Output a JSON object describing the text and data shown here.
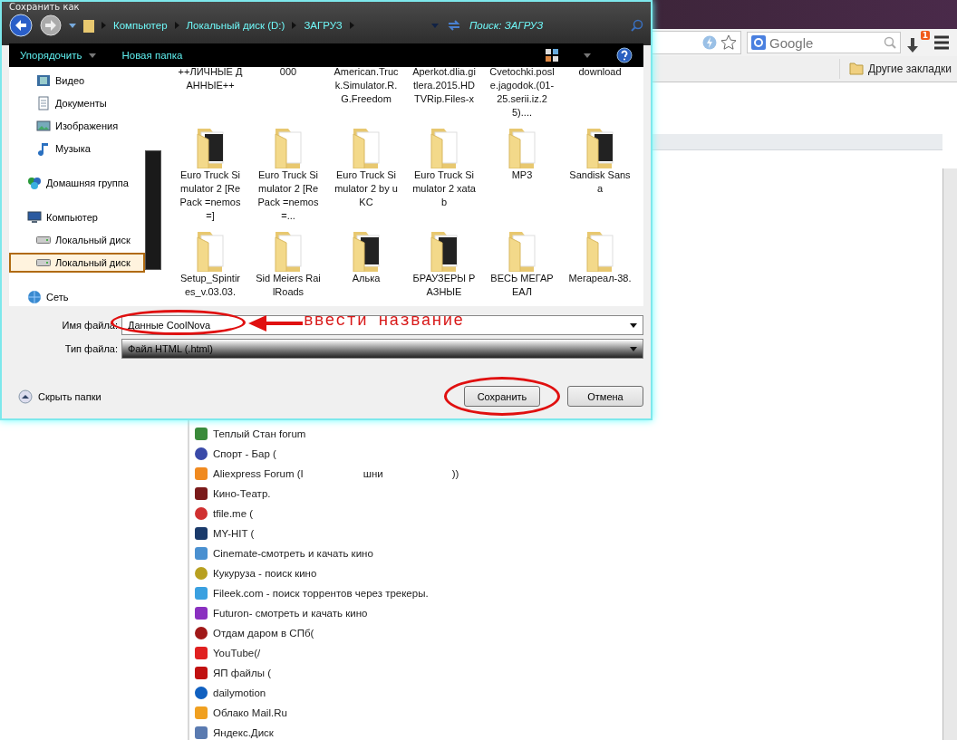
{
  "browser": {
    "search": {
      "placeholder": "Google"
    },
    "download_badge": "1",
    "bookmarks_bar": {
      "other": "Другие закладки"
    },
    "bookmarks": [
      {
        "text": "Теплый Стан forum",
        "color": "#3a8a3a"
      },
      {
        "text": "Спорт - Бар (",
        "color": "#3a4aa8"
      },
      {
        "text": "Aliexpress Forum (I",
        "color": "#f08a20",
        "fragments": [
          "шни",
          "))"
        ]
      },
      {
        "text": "Кино-Театр.",
        "color": "#7a1a1a"
      },
      {
        "text": "tfile.me (",
        "color": "#d03030"
      },
      {
        "text": "MY-HIT (",
        "color": "#1a3a6a"
      },
      {
        "text": "Cinemate-смотреть и качать кино",
        "color": "#4a90d0"
      },
      {
        "text": "Кукуруза - поиск кино",
        "color": "#b8a020"
      },
      {
        "text": "Fileek.com - поиск торрентов через трекеры.",
        "color": "#3aa0e0"
      },
      {
        "text": "Futuron- смотреть и качать кино",
        "color": "#8a30c0"
      },
      {
        "text": "Отдам даром в СПб(",
        "color": "#a01818"
      },
      {
        "text": "YouTube(/",
        "color": "#e02020"
      },
      {
        "text": "ЯП файлы (",
        "color": "#c01010"
      },
      {
        "text": "dailymotion",
        "color": "#1060c0"
      },
      {
        "text": "Облако Mail.Ru",
        "color": "#f0a020"
      },
      {
        "text": "Яндекс.Диск",
        "color": "#5a7ab0"
      }
    ]
  },
  "dialog": {
    "title": "Сохранить как",
    "breadcrumbs": [
      "Компьютер",
      "Локальный диск (D:)",
      "ЗАГРУЗ"
    ],
    "search": {
      "placeholder": "Поиск: ЗАГРУЗ"
    },
    "toolbar": {
      "organize": "Упорядочить",
      "new_folder": "Новая папка"
    },
    "nav": [
      {
        "children": [
          {
            "label": "Видео",
            "kind": "video",
            "selected": false
          },
          {
            "label": "Документы",
            "kind": "docs",
            "selected": false
          },
          {
            "label": "Изображения",
            "kind": "images",
            "selected": false
          },
          {
            "label": "Музыка",
            "kind": "music",
            "selected": false
          }
        ]
      },
      {
        "label": "Домашняя группа",
        "kind": "homegroup",
        "selected": false
      },
      {
        "label": "Компьютер",
        "kind": "computer",
        "selected": false,
        "children": [
          {
            "label": "Локальный диск",
            "kind": "drive",
            "selected": false
          },
          {
            "label": "Локальный диск",
            "kind": "drive",
            "selected": true
          }
        ]
      },
      {
        "label": "Сеть",
        "kind": "network",
        "selected": false
      }
    ],
    "files": [
      {
        "name": "++ЛИЧНЫЕ ДАННЫЕ++",
        "kind": "name_only"
      },
      {
        "name": "000",
        "kind": "name_only"
      },
      {
        "name": "American.Truck.Simulator.R.G.Freedom",
        "kind": "name_only"
      },
      {
        "name": "Aperkot.dlia.gitlera.2015.HDTVRip.Files-x",
        "kind": "name_only"
      },
      {
        "name": "Cvetochki.posle.jagodok.(01-25.serii.iz.25)....",
        "kind": "name_only"
      },
      {
        "name": "download",
        "kind": "name_only"
      },
      {
        "name": "Euro Truck Simulator 2 [RePack =nemos=]",
        "kind": "preview"
      },
      {
        "name": "Euro Truck Simulator 2 [RePack =nemos=...",
        "kind": "folder"
      },
      {
        "name": "Euro Truck Simulator 2 by uKC",
        "kind": "folder"
      },
      {
        "name": "Euro Truck Simulator 2 xatab",
        "kind": "folder"
      },
      {
        "name": "MP3",
        "kind": "music_folder"
      },
      {
        "name": "Sandisk Sansa",
        "kind": "preview"
      },
      {
        "name": "Setup_Spintires_v.03.03.",
        "kind": "folder"
      },
      {
        "name": "Sid Meiers RailRoads",
        "kind": "folder"
      },
      {
        "name": "Алька",
        "kind": "preview"
      },
      {
        "name": "БРАУЗЕРЫ РАЗНЫЕ",
        "kind": "preview"
      },
      {
        "name": "ВЕСЬ МЕГАРЕАЛ",
        "kind": "folder"
      },
      {
        "name": "Мегареал-38.",
        "kind": "folder"
      }
    ],
    "filename": {
      "label": "Имя файла:",
      "value": "Данные CoolNova"
    },
    "filetype": {
      "label": "Тип файла:",
      "value": "Файл HTML (.html)"
    },
    "hide_folders": "Скрыть папки",
    "buttons": [
      {
        "label": "Сохранить",
        "kind": "primary"
      },
      {
        "label": "Отмена",
        "kind": "cancel"
      }
    ],
    "annotation": {
      "text": "ввести название"
    }
  }
}
